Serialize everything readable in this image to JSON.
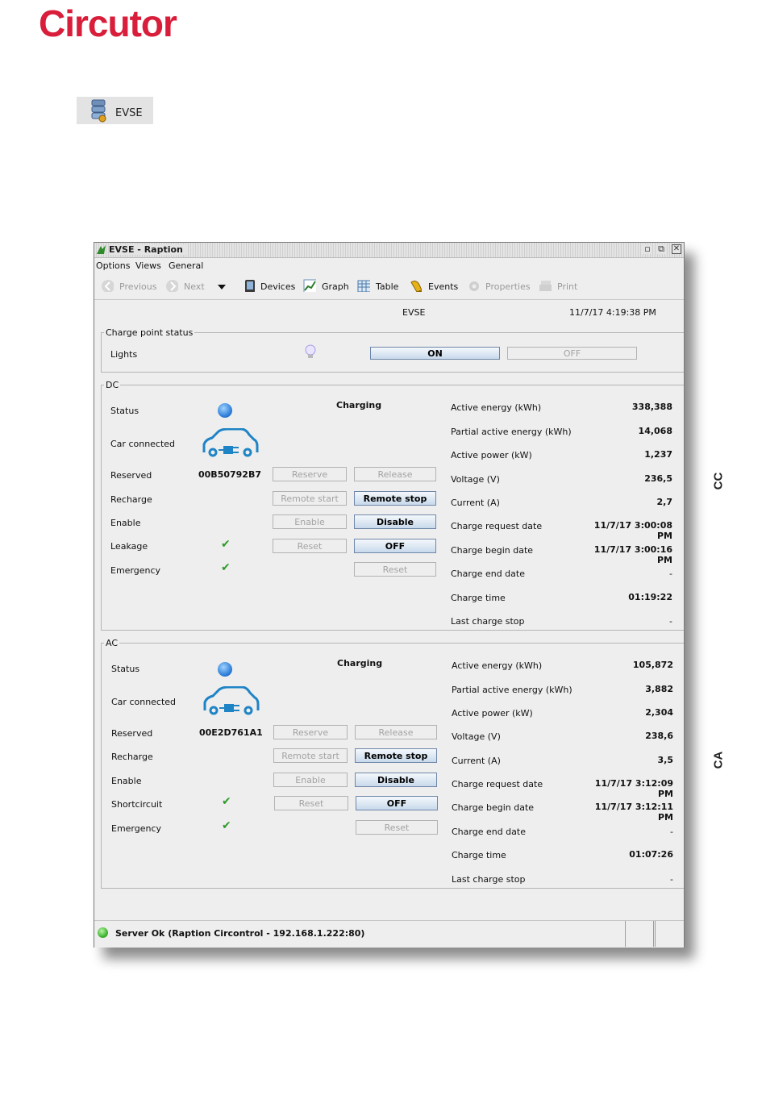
{
  "logo": {
    "text": "Circutor"
  },
  "evse_icon": {
    "label": "EVSE",
    "icon": "server-stack-icon"
  },
  "side_labels": {
    "dc": "CC",
    "ac": "CA"
  },
  "window": {
    "title": "EVSE - Raption",
    "menu": [
      "Options",
      "Views",
      "General"
    ],
    "toolbar": {
      "previous": "Previous",
      "next": "Next",
      "devices": "Devices",
      "graph": "Graph",
      "table": "Table",
      "events": "Events",
      "properties": "Properties",
      "print": "Print"
    },
    "device": "EVSE",
    "datetime": "11/7/17 4:19:38 PM",
    "charge_point": {
      "legend": "Charge point status",
      "lights_label": "Lights",
      "on_label": "ON",
      "off_label": "OFF"
    },
    "dc": {
      "legend": "DC",
      "status_label": "Status",
      "status_value": "Charging",
      "car_connected_label": "Car connected",
      "reserved_label": "Reserved",
      "reserved_id": "00B50792B7",
      "reserve_btn": "Reserve",
      "release_btn": "Release",
      "recharge_label": "Recharge",
      "remote_start_btn": "Remote start",
      "remote_stop_btn": "Remote stop",
      "enable_label": "Enable",
      "enable_btn": "Enable",
      "disable_btn": "Disable",
      "fault_label": "Leakage",
      "fault_reset_btn": "Reset",
      "fault_off_btn": "OFF",
      "emergency_label": "Emergency",
      "emergency_reset_btn": "Reset",
      "measures": [
        {
          "label": "Active energy (kWh)",
          "value": "338,388"
        },
        {
          "label": "Partial active energy (kWh)",
          "value": "14,068"
        },
        {
          "label": "Active power (kW)",
          "value": "1,237"
        },
        {
          "label": "Voltage (V)",
          "value": "236,5"
        },
        {
          "label": "Current (A)",
          "value": "2,7"
        },
        {
          "label": "Charge request date",
          "value": "11/7/17 3:00:08 PM"
        },
        {
          "label": "Charge begin date",
          "value": "11/7/17 3:00:16 PM"
        },
        {
          "label": "Charge end date",
          "value": "-"
        },
        {
          "label": "Charge time",
          "value": "01:19:22"
        },
        {
          "label": "Last charge stop",
          "value": "-"
        }
      ]
    },
    "ac": {
      "legend": "AC",
      "status_label": "Status",
      "status_value": "Charging",
      "car_connected_label": "Car connected",
      "reserved_label": "Reserved",
      "reserved_id": "00E2D761A1",
      "reserve_btn": "Reserve",
      "release_btn": "Release",
      "recharge_label": "Recharge",
      "remote_start_btn": "Remote start",
      "remote_stop_btn": "Remote stop",
      "enable_label": "Enable",
      "enable_btn": "Enable",
      "disable_btn": "Disable",
      "fault_label": "Shortcircuit",
      "fault_reset_btn": "Reset",
      "fault_off_btn": "OFF",
      "emergency_label": "Emergency",
      "emergency_reset_btn": "Reset",
      "measures": [
        {
          "label": "Active energy (kWh)",
          "value": "105,872"
        },
        {
          "label": "Partial active energy (kWh)",
          "value": "3,882"
        },
        {
          "label": "Active power (kW)",
          "value": "2,304"
        },
        {
          "label": "Voltage (V)",
          "value": "238,6"
        },
        {
          "label": "Current (A)",
          "value": "3,5"
        },
        {
          "label": "Charge request date",
          "value": "11/7/17 3:12:09 PM"
        },
        {
          "label": "Charge begin date",
          "value": "11/7/17 3:12:11 PM"
        },
        {
          "label": "Charge end date",
          "value": "-"
        },
        {
          "label": "Charge time",
          "value": "01:07:26"
        },
        {
          "label": "Last charge stop",
          "value": "-"
        }
      ]
    },
    "statusbar": {
      "text": "Server Ok (Raption Circontrol - 192.168.1.222:80)"
    }
  },
  "colors": {
    "brand": "#d81e3a",
    "accent_blue": "#1f84c6",
    "ok_green": "#2f9a2a"
  }
}
